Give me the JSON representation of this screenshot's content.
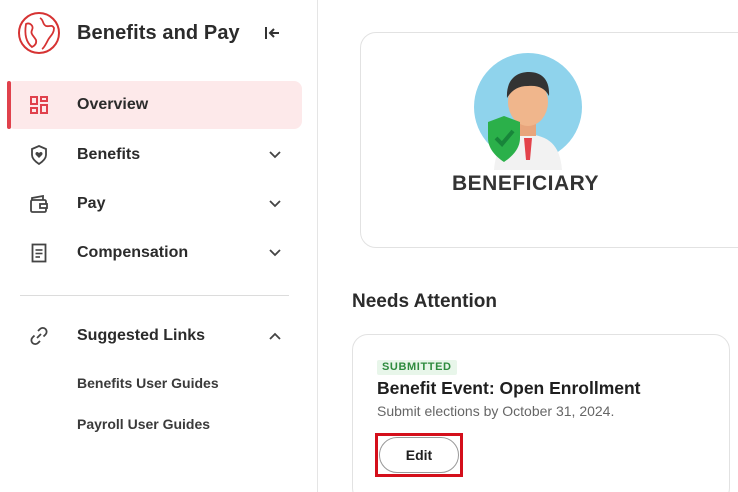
{
  "app": {
    "title": "Benefits and Pay"
  },
  "nav": {
    "items": [
      {
        "label": "Overview",
        "icon": "dashboard-icon",
        "active": true
      },
      {
        "label": "Benefits",
        "icon": "shield-heart-icon"
      },
      {
        "label": "Pay",
        "icon": "wallet-icon"
      },
      {
        "label": "Compensation",
        "icon": "document-icon"
      }
    ],
    "suggested": {
      "label": "Suggested Links",
      "links": [
        "Benefits User Guides",
        "Payroll User Guides"
      ]
    }
  },
  "hero": {
    "caption": "BENEFICIARY"
  },
  "attention": {
    "title": "Needs Attention",
    "task": {
      "status": "SUBMITTED",
      "title": "Benefit Event: Open Enrollment",
      "subtitle": "Submit elections by October 31, 2024.",
      "action_label": "Edit"
    }
  },
  "colors": {
    "accent": "#e0414c",
    "active_bg": "#fde9ea",
    "status_green": "#2e8b3e",
    "highlight": "#d40f1b"
  }
}
